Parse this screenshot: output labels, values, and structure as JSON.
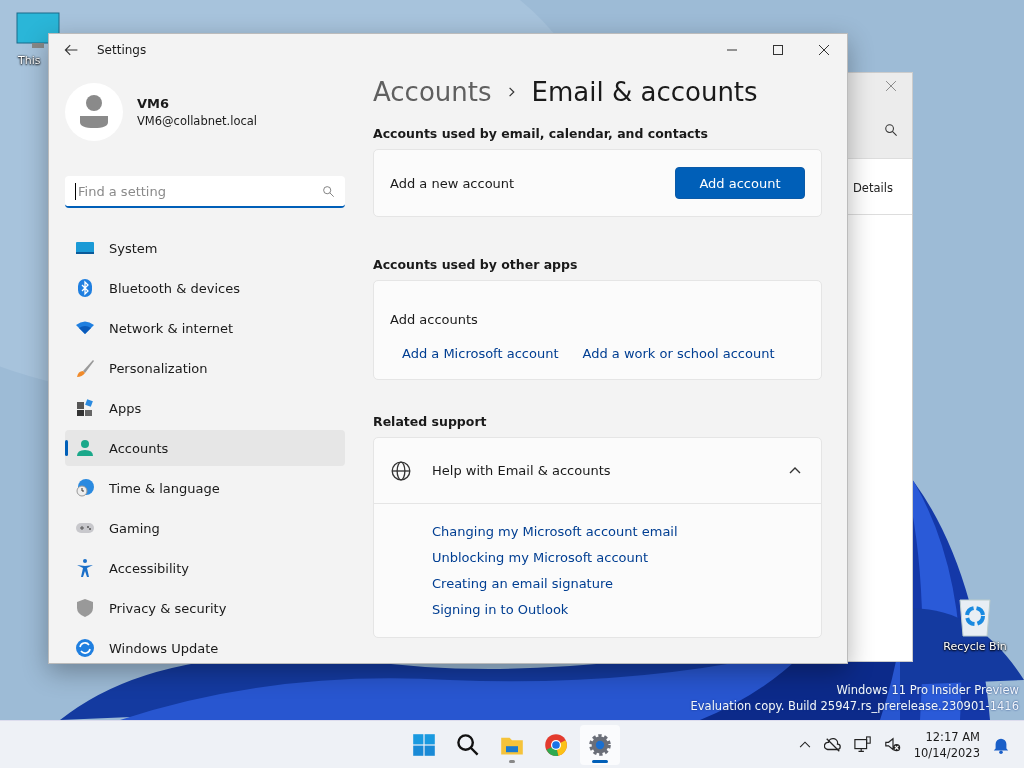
{
  "desktop": {
    "icons": [
      {
        "label": "This",
        "kind": "pc"
      },
      {
        "label": "Recycle Bin",
        "kind": "bin"
      }
    ],
    "watermark": [
      "Windows 11 Pro Insider Preview",
      "Evaluation copy. Build 25947.rs_prerelease.230901-1416"
    ]
  },
  "background_window": {
    "column": "Details"
  },
  "settings": {
    "title": "Settings",
    "user": {
      "name": "VM6",
      "email": "VM6@collabnet.local"
    },
    "search": {
      "placeholder": "Find a setting"
    },
    "nav": [
      {
        "label": "System",
        "kind": "system",
        "selected": false
      },
      {
        "label": "Bluetooth & devices",
        "kind": "bluetooth",
        "selected": false
      },
      {
        "label": "Network & internet",
        "kind": "network",
        "selected": false
      },
      {
        "label": "Personalization",
        "kind": "brush",
        "selected": false
      },
      {
        "label": "Apps",
        "kind": "apps",
        "selected": false
      },
      {
        "label": "Accounts",
        "kind": "accounts",
        "selected": true
      },
      {
        "label": "Time & language",
        "kind": "time",
        "selected": false
      },
      {
        "label": "Gaming",
        "kind": "gaming",
        "selected": false
      },
      {
        "label": "Accessibility",
        "kind": "accessibility",
        "selected": false
      },
      {
        "label": "Privacy & security",
        "kind": "privacy",
        "selected": false
      },
      {
        "label": "Windows Update",
        "kind": "update",
        "selected": false
      }
    ],
    "breadcrumb": [
      "Accounts",
      "Email & accounts"
    ],
    "email_section": {
      "heading": "Accounts used by email, calendar, and contacts",
      "label": "Add a new account",
      "button": "Add account"
    },
    "apps_section": {
      "heading": "Accounts used by other apps",
      "label": "Add accounts",
      "links": [
        "Add a Microsoft account",
        "Add a work or school account"
      ]
    },
    "support": {
      "heading": "Related support",
      "title": "Help with Email & accounts",
      "expanded": true,
      "links": [
        "Changing my Microsoft account email",
        "Unblocking my Microsoft account",
        "Creating an email signature",
        "Signing in to Outlook"
      ]
    }
  },
  "taskbar": {
    "apps": [
      {
        "kind": "start",
        "running": false,
        "selected": false
      },
      {
        "kind": "search",
        "running": false,
        "selected": false
      },
      {
        "kind": "explorer",
        "running": true,
        "selected": false
      },
      {
        "kind": "chrome",
        "running": false,
        "selected": false
      },
      {
        "kind": "settings",
        "running": true,
        "selected": true
      }
    ],
    "clock": {
      "time": "12:17 AM",
      "date": "10/14/2023"
    }
  }
}
